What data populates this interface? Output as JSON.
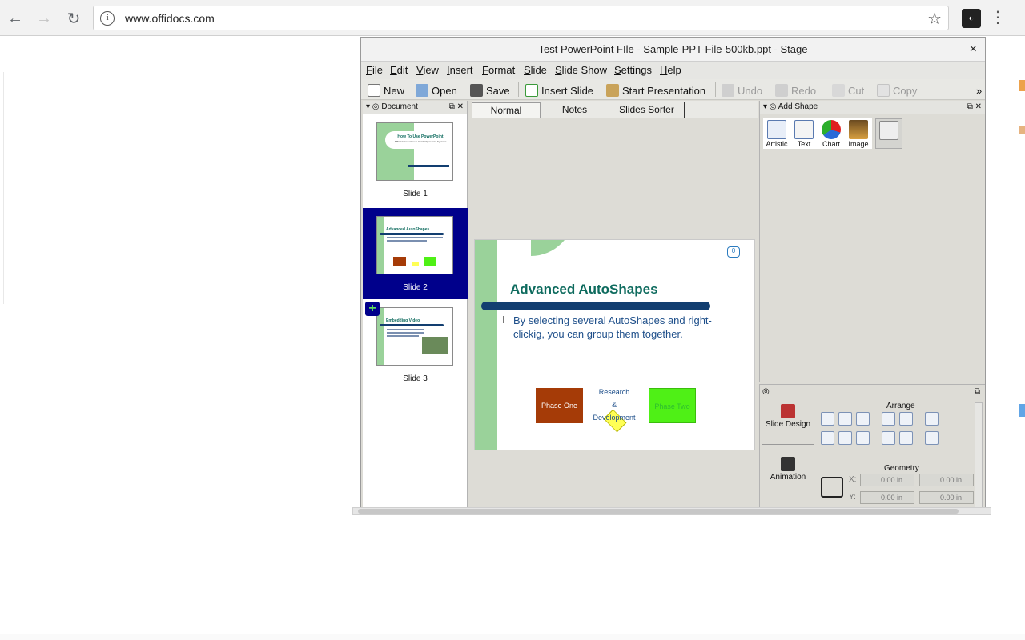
{
  "browser": {
    "url": "www.offidocs.com",
    "back_icon": "arrow-left-icon",
    "forward_icon": "arrow-right-icon",
    "reload_icon": "reload-icon"
  },
  "window": {
    "title": "Test PowerPoint FIle - Sample-PPT-File-500kb.ppt - Stage",
    "close": "×"
  },
  "menu": [
    "File",
    "Edit",
    "View",
    "Insert",
    "Format",
    "Slide",
    "Slide Show",
    "Settings",
    "Help"
  ],
  "toolbar": {
    "new": "New",
    "open": "Open",
    "save": "Save",
    "insert_slide": "Insert Slide",
    "start_presentation": "Start Presentation",
    "undo": "Undo",
    "redo": "Redo",
    "cut": "Cut",
    "copy": "Copy",
    "more": "»"
  },
  "document_panel": {
    "title": "Document",
    "slides": [
      {
        "caption": "Slide 1",
        "title": "How To Use PowerPoint",
        "subtitle": "A Brief Introduction to Cambridge's Intel Systems"
      },
      {
        "caption": "Slide 2",
        "title": "Advanced AutoShapes",
        "selected": true
      },
      {
        "caption": "Slide 3",
        "title": "Embedding Video"
      }
    ]
  },
  "view_tabs": [
    "Normal",
    "Notes",
    "Slides Sorter"
  ],
  "slide": {
    "title": "Advanced AutoShapes",
    "body": "By selecting several AutoShapes and right-clickig, you can group them together.",
    "comment_count": "0",
    "phase_one": "Phase One",
    "phase_two": "Phase Two",
    "rd_line1": "Research",
    "rd_line2": "&",
    "rd_line3": "Development"
  },
  "add_shape": {
    "title": "Add Shape",
    "items": [
      "Artistic",
      "Text",
      "Chart",
      "Image"
    ]
  },
  "properties": {
    "slide_design": "Slide Design",
    "animation": "Animation",
    "arrange": "Arrange",
    "geometry": "Geometry",
    "x_label": "X:",
    "y_label": "Y:",
    "x_value": "0.00 in",
    "x_value2": "0.00 in",
    "y_value": "0.00 in",
    "y_value2": "0.00 in"
  },
  "colors": {
    "selected_thumb_bg": "#00008b",
    "slide_title": "#0e6b5e",
    "phase_one": "#a53b07",
    "phase_two": "#4ff016"
  }
}
